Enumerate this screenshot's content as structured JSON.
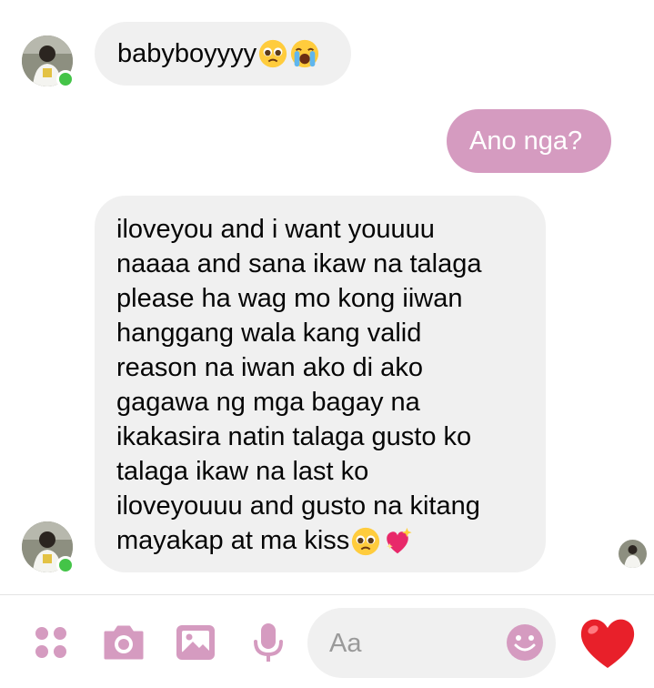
{
  "conversation": {
    "messages": [
      {
        "direction": "incoming",
        "text": "babyboyyyy",
        "emoji": [
          "pleading-face",
          "loudly-crying-face"
        ]
      },
      {
        "direction": "outgoing",
        "text": "Ano nga?"
      },
      {
        "direction": "incoming",
        "lines": [
          "iloveyou and i want youuuu",
          "naaaa and sana ikaw na talaga",
          "please ha wag mo kong iiwan",
          "hanggang wala kang valid",
          "reason na iwan ako di ako",
          "gagawa ng mga bagay na",
          "ikakasira natin talaga gusto ko",
          "talaga ikaw na last ko",
          "iloveyouuu and gusto na kitang",
          "mayakap at ma kiss"
        ],
        "emoji": [
          "pleading-face",
          "sparkling-heart"
        ]
      }
    ]
  },
  "composer": {
    "placeholder": "Aa",
    "icons": [
      "menu-dots-icon",
      "camera-icon",
      "gallery-icon",
      "microphone-icon",
      "emoji-icon",
      "heart-icon"
    ]
  },
  "colors": {
    "accent": "#d59bc0",
    "incoming_bubble": "#f0f0f0",
    "online": "#44c448",
    "heart": "#e8202a"
  }
}
